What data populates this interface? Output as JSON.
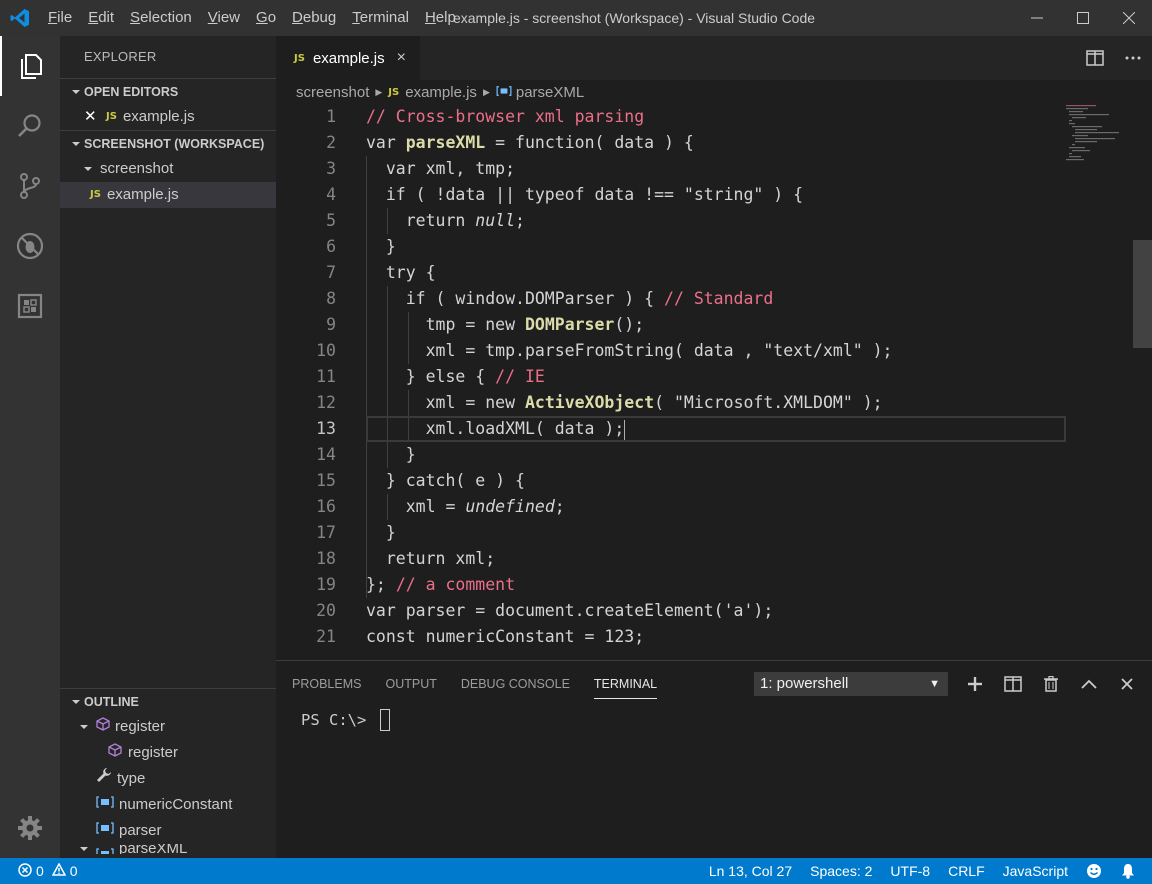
{
  "window": {
    "title": "example.js - screenshot (Workspace) - Visual Studio Code",
    "menu": [
      {
        "underline": "F",
        "rest": "ile"
      },
      {
        "underline": "E",
        "rest": "dit"
      },
      {
        "underline": "S",
        "rest": "election"
      },
      {
        "underline": "V",
        "rest": "iew"
      },
      {
        "underline": "G",
        "rest": "o"
      },
      {
        "underline": "D",
        "rest": "ebug"
      },
      {
        "underline": "T",
        "rest": "erminal"
      },
      {
        "underline": "H",
        "rest": "elp"
      }
    ]
  },
  "sidebar": {
    "title": "EXPLORER",
    "open_editors_label": "OPEN EDITORS",
    "open_editor_file": "example.js",
    "workspace_label": "SCREENSHOT (WORKSPACE)",
    "folder": "screenshot",
    "file": "example.js",
    "outline_label": "OUTLINE",
    "outline_items": [
      "register",
      "register",
      "type",
      "numericConstant",
      "parser",
      "parseXML"
    ]
  },
  "tab": {
    "js_badge": "JS",
    "label": "example.js",
    "close": "×"
  },
  "breadcrumb": {
    "folder": "screenshot",
    "file": "example.js",
    "symbol": "parseXML"
  },
  "editor": {
    "current_line": 13,
    "lines": [
      {
        "n": "1"
      },
      {
        "n": "2"
      },
      {
        "n": "3"
      },
      {
        "n": "4"
      },
      {
        "n": "5"
      },
      {
        "n": "6"
      },
      {
        "n": "7"
      },
      {
        "n": "8"
      },
      {
        "n": "9"
      },
      {
        "n": "10"
      },
      {
        "n": "11"
      },
      {
        "n": "12"
      },
      {
        "n": "13"
      },
      {
        "n": "14"
      },
      {
        "n": "15"
      },
      {
        "n": "16"
      },
      {
        "n": "17"
      },
      {
        "n": "18"
      },
      {
        "n": "19"
      },
      {
        "n": "20"
      },
      {
        "n": "21"
      }
    ],
    "code": {
      "l1": "// Cross-browser xml parsing",
      "l2a": "var ",
      "l2b": "parseXML",
      "l2c": " = function( data ) {",
      "l3": "  var xml, tmp;",
      "l4": "  if ( !data || typeof data !== \"string\" ) {",
      "l5a": "    return ",
      "l5b": "null",
      "l5c": ";",
      "l6": "  }",
      "l7": "  try {",
      "l8a": "    if ( window.DOMParser ) { ",
      "l8b": "// Standard",
      "l9a": "      tmp = new ",
      "l9b": "DOMParser",
      "l9c": "();",
      "l10": "      xml = tmp.parseFromString( data , \"text/xml\" );",
      "l11a": "    } else { ",
      "l11b": "// IE",
      "l12a": "      xml = new ",
      "l12b": "ActiveXObject",
      "l12c": "( \"Microsoft.XMLDOM\" );",
      "l13": "      xml.loadXML( data );",
      "l14": "    }",
      "l15": "  } catch( e ) {",
      "l16a": "    xml = ",
      "l16b": "undefined",
      "l16c": ";",
      "l17": "  }",
      "l18": "  return xml;",
      "l19a": "}; ",
      "l19b": "// a comment",
      "l20": "var parser = document.createElement('a');",
      "l21": "const numericConstant = 123;"
    }
  },
  "panel": {
    "tabs": [
      "PROBLEMS",
      "OUTPUT",
      "DEBUG CONSOLE",
      "TERMINAL"
    ],
    "active_tab": "TERMINAL",
    "terminal_select": "1: powershell",
    "prompt": "PS C:\\> "
  },
  "statusbar": {
    "errors": "0",
    "warnings": "0",
    "position": "Ln 13, Col 27",
    "spaces": "Spaces: 2",
    "encoding": "UTF-8",
    "eol": "CRLF",
    "language": "JavaScript"
  },
  "colors": {
    "accent": "#007acc",
    "comment": "#ec6f89",
    "function": "#dcdcaa",
    "js_badge": "#cbcb41"
  }
}
